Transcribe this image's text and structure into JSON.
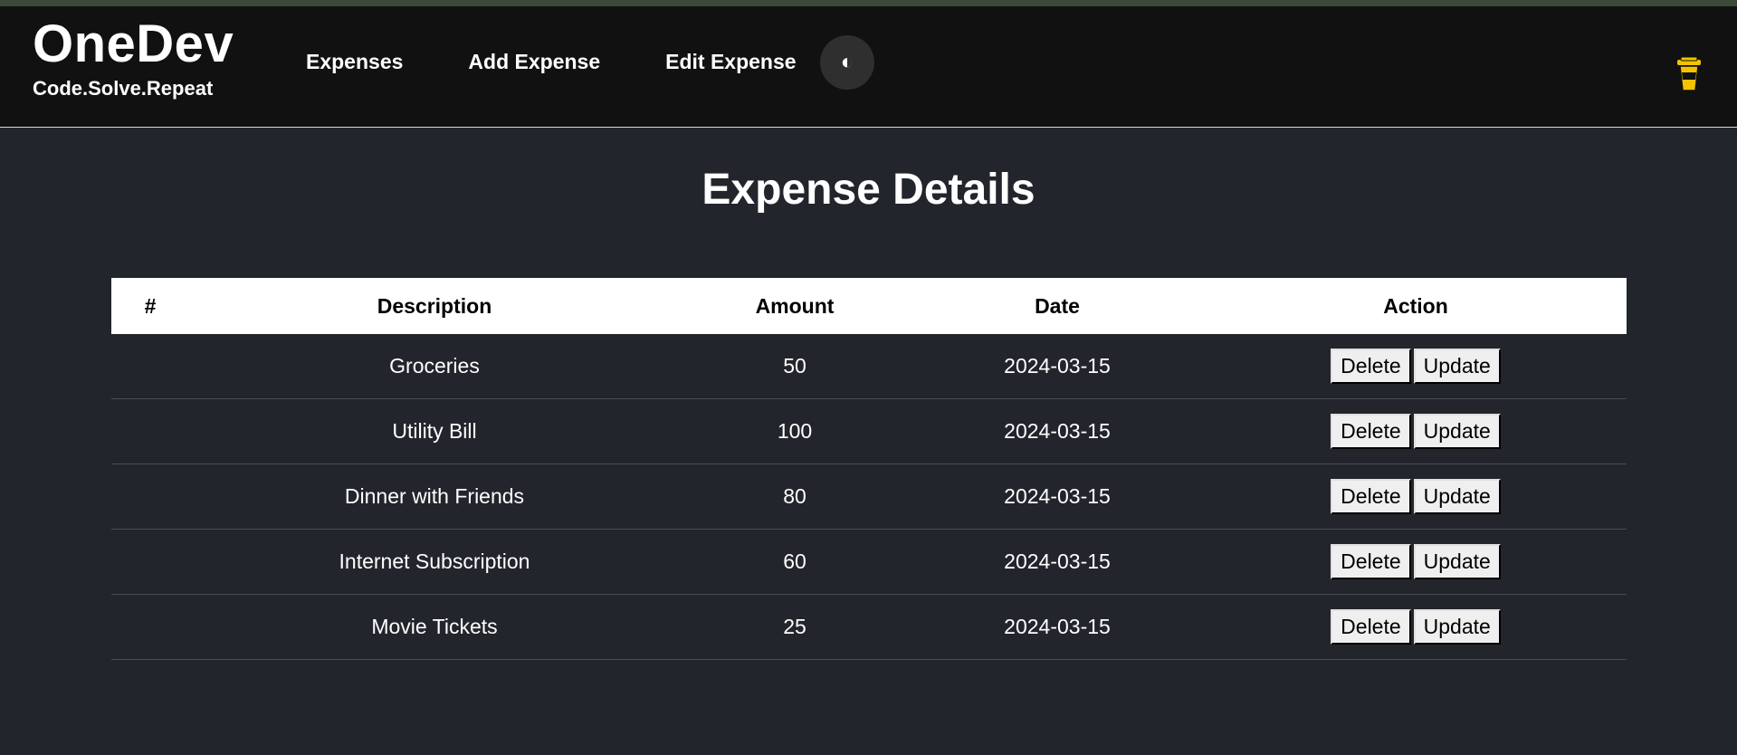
{
  "brand": {
    "title": "OneDev",
    "tagline": "Code.Solve.Repeat"
  },
  "nav": {
    "items": [
      {
        "label": "Expenses"
      },
      {
        "label": "Add Expense"
      },
      {
        "label": "Edit Expense"
      }
    ],
    "theme_toggle_icon": "contrast-icon",
    "coffee_icon": "coffee-cup-icon"
  },
  "colors": {
    "header_bg": "#111111",
    "page_bg": "#22252b",
    "accent_icon": "#f2c400"
  },
  "main": {
    "title": "Expense Details"
  },
  "table": {
    "headers": [
      "#",
      "Description",
      "Amount",
      "Date",
      "Action"
    ],
    "action_labels": {
      "delete": "Delete",
      "update": "Update"
    },
    "rows": [
      {
        "num": "",
        "description": "Groceries",
        "amount": "50",
        "date": "2024-03-15"
      },
      {
        "num": "",
        "description": "Utility Bill",
        "amount": "100",
        "date": "2024-03-15"
      },
      {
        "num": "",
        "description": "Dinner with Friends",
        "amount": "80",
        "date": "2024-03-15"
      },
      {
        "num": "",
        "description": "Internet Subscription",
        "amount": "60",
        "date": "2024-03-15"
      },
      {
        "num": "",
        "description": "Movie Tickets",
        "amount": "25",
        "date": "2024-03-15"
      }
    ]
  }
}
